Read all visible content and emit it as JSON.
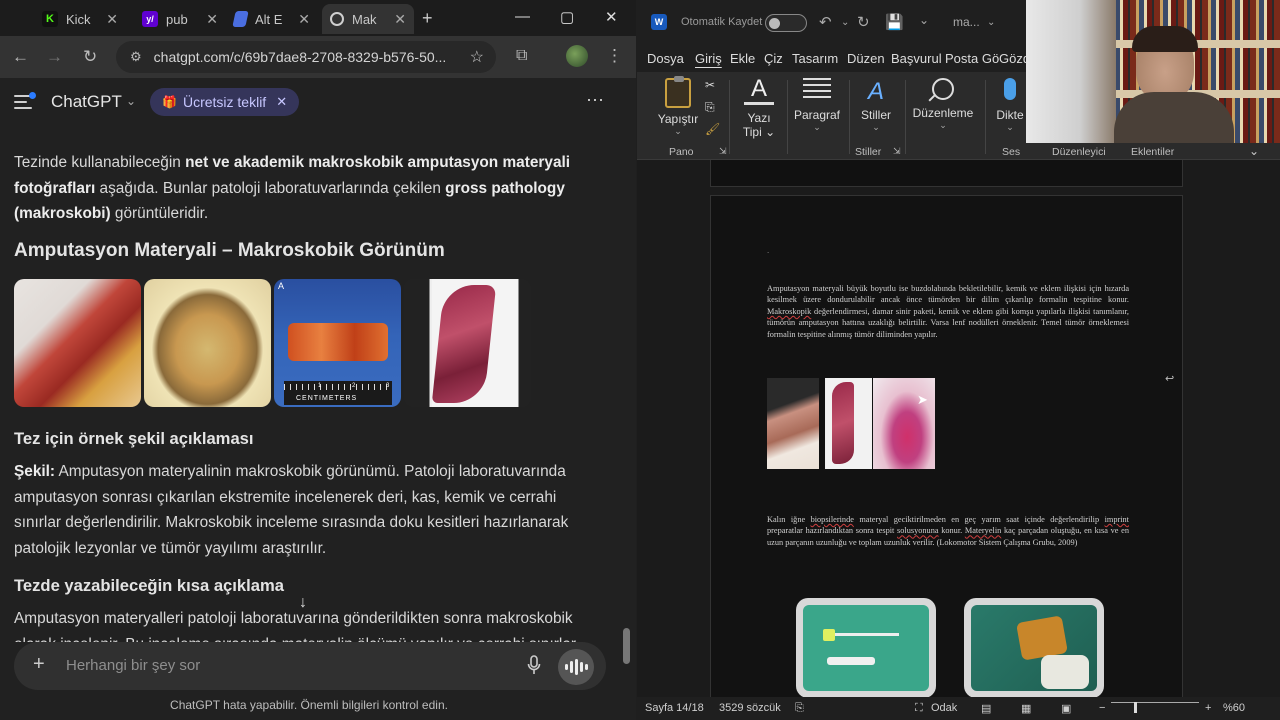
{
  "browser": {
    "tabs": [
      {
        "title": "Kick",
        "favicon_text": "K",
        "favicon_color": "#53fc18",
        "favicon_bg": "#111111"
      },
      {
        "title": "pub",
        "favicon_text": "y/",
        "favicon_color": "#ffffff",
        "favicon_bg": "#6001d2"
      },
      {
        "title": "Alt E",
        "favicon_text": "",
        "favicon_color": "#ffffff",
        "favicon_bg": "#4a6ee0"
      },
      {
        "title": "Mak",
        "favicon_text": "",
        "favicon_color": "#ffffff",
        "favicon_bg": "#444444",
        "active": true
      }
    ],
    "new_tab": "+",
    "url": "chatgpt.com/c/69b7dae8-2708-8329-b576-50..."
  },
  "chatgpt": {
    "title": "ChatGPT",
    "offer_label": "Ücretsiz teklif",
    "intro": {
      "p1": "Tezinde kullanabileceğin ",
      "b1": "net ve akademik makroskobik amputasyon materyali fotoğrafları",
      "p2": " aşağıda. Bunlar patoloji laboratuvarlarında çekilen ",
      "b2": "gross pathology (makroskobi)",
      "p3": " görüntüleridir."
    },
    "section_title": "Amputasyon Materyali – Makroskobik Görünüm",
    "image_labels": {
      "a": "A",
      "ruler": "CENTIMETERS",
      "ruler_ticks": [
        "1",
        "2",
        "3"
      ]
    },
    "caption_title": "Tez için örnek şekil açıklaması",
    "caption_label": "Şekil:",
    "caption_text": " Amputasyon materyalinin makroskobik görünümü. Patoloji laboratuvarında amputasyon sonrası çıkarılan ekstremite incelenerek deri, kas, kemik ve cerrahi sınırlar değerlendirilir. Makroskobik inceleme sırasında doku kesitleri hazırlanarak patolojik lezyonlar ve tümör yayılımı araştırılır.",
    "short_title": "Tezde yazabileceğin kısa açıklama",
    "short_text": "Amputasyon materyalleri patoloji laboratuvarına gönderildikten sonra makroskobik olarak incelenir. Bu inceleme sırasında materyalin ölçümü yapılır ve cerrahi sınırlar",
    "composer_placeholder": "Herhangi bir şey sor",
    "disclaimer": "ChatGPT hata yapabilir. Önemli bilgileri kontrol edin."
  },
  "word": {
    "autosave_label": "Otomatik Kaydet",
    "doc_name": "ma...",
    "menu": [
      "Dosya",
      "Giriş",
      "Ekle",
      "Çiz",
      "Tasarım",
      "Düzen",
      "Başvurul",
      "Posta Gö",
      "Gözd"
    ],
    "ribbon": {
      "paste": "Yapıştır",
      "font_l1": "Yazı",
      "font_l2": "Tipi",
      "paragraph": "Paragraf",
      "styles": "Stiller",
      "editing": "Düzenleme",
      "dictate": "Dikte",
      "groups": [
        "Pano",
        "Stiller",
        "Ses",
        "Düzenleyici",
        "Eklentiler"
      ]
    },
    "page": {
      "dot": ".",
      "para1": [
        {
          "t": " Amputasyon materyali büyük boyutlu ise buzdolabında bekletilebilir, kemik ve eklem ilişkisi için hızarda kesilmek üzere dondurulabilir ancak önce tümörden bir dilim çıkarılıp formalin tespitine konur. "
        },
        {
          "t": "Makroskopik",
          "sq": true
        },
        {
          "t": " değerlendirmesi, damar sinir paketi, kemik ve eklem gibi komşu yapılarla ilişkisi tanımlanır, tümörün amputasyon hattına uzaklığı belirtilir. Varsa lenf nodülleri örneklenir. Temel tümör örneklemesi formalin tespitine alınmış tümör diliminden yapılır."
        }
      ],
      "para2": [
        {
          "t": " Kalın iğne "
        },
        {
          "t": "biopsilerinde",
          "sq": true
        },
        {
          "t": " materyal geciktirilmeden en geç yarım saat içinde değerlendirilip "
        },
        {
          "t": "imprint",
          "sq": true
        },
        {
          "t": " preparatlar hazırlandıktan sonra tespit "
        },
        {
          "t": "solusyonuna",
          "sq": true
        },
        {
          "t": " konur. "
        },
        {
          "t": "Materyelin",
          "sq": true
        },
        {
          "t": " kaç parçadan oluştuğu, en kısa ve en uzun parçanın uzunluğu ve toplam uzunluk verilir. (Lokomotor Sistem Çalışma Grubu, 2009)"
        }
      ]
    },
    "status": {
      "page": "Sayfa 14/18",
      "words": "3529 sözcük",
      "focus": "Odak",
      "zoom": "%60",
      "zoom_level": 60
    }
  }
}
